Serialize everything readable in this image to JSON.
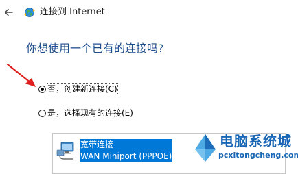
{
  "header": {
    "back_icon": "arrow-left-icon",
    "app_icon": "internet-connection-icon",
    "title": "连接到 Internet"
  },
  "main": {
    "question": "你想使用一个已有的连接吗?",
    "options": [
      {
        "label": "否，创建新连接(C)",
        "selected": true
      },
      {
        "label": "是，选择现有的连接(E)",
        "selected": false
      }
    ],
    "connection_list": {
      "items": [
        {
          "icon": "broadband-network-icon",
          "name": "宽带连接",
          "device": "WAN Miniport (PPPOE)"
        }
      ]
    }
  },
  "watermark": {
    "title": "电脑系统城",
    "url": "pcxitongcheng.com"
  },
  "colors": {
    "question_text": "#1f4e8c",
    "selection_highlight": "#0078d7",
    "annotation_arrow": "#e02020",
    "watermark": "#1866b5"
  }
}
